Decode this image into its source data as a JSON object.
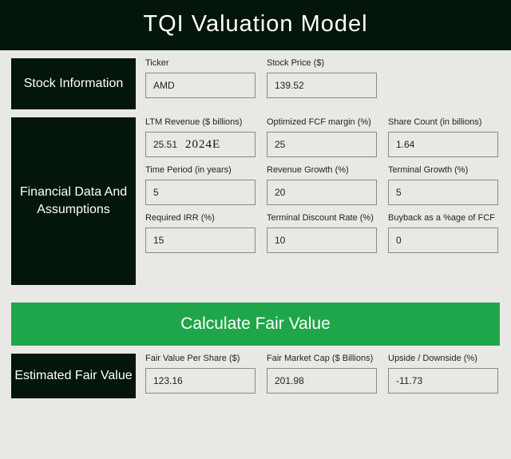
{
  "title": "TQI Valuation Model",
  "sections": {
    "stock": {
      "label": "Stock Information",
      "fields": {
        "ticker": {
          "label": "Ticker",
          "value": "AMD"
        },
        "price": {
          "label": "Stock Price ($)",
          "value": "139.52"
        }
      }
    },
    "fin": {
      "label": "Financial Data And Assumptions",
      "fields": {
        "ltm_rev": {
          "label": "LTM Revenue ($ billions)",
          "value": "25.51",
          "note": "2024E"
        },
        "opt_fcf": {
          "label": "Optimized FCF margin (%)",
          "value": "25"
        },
        "shares": {
          "label": "Share Count (in billions)",
          "value": "1.64"
        },
        "period": {
          "label": "Time Period (in years)",
          "value": "5"
        },
        "rev_growth": {
          "label": "Revenue Growth (%)",
          "value": "20"
        },
        "term_growth": {
          "label": "Terminal Growth (%)",
          "value": "5"
        },
        "req_irr": {
          "label": "Required IRR (%)",
          "value": "15"
        },
        "term_disc": {
          "label": "Terminal Discount Rate (%)",
          "value": "10"
        },
        "buyback": {
          "label": "Buyback as a %age of FCF",
          "value": "0"
        }
      }
    },
    "est": {
      "label": "Estimated Fair Value",
      "fields": {
        "fv_share": {
          "label": "Fair Value Per Share ($)",
          "value": "123.16"
        },
        "fv_mcap": {
          "label": "Fair Market Cap ($ Billions)",
          "value": "201.98"
        },
        "upside": {
          "label": "Upside / Downside (%)",
          "value": "-11.73"
        }
      }
    }
  },
  "button": {
    "label": "Calculate Fair Value"
  }
}
